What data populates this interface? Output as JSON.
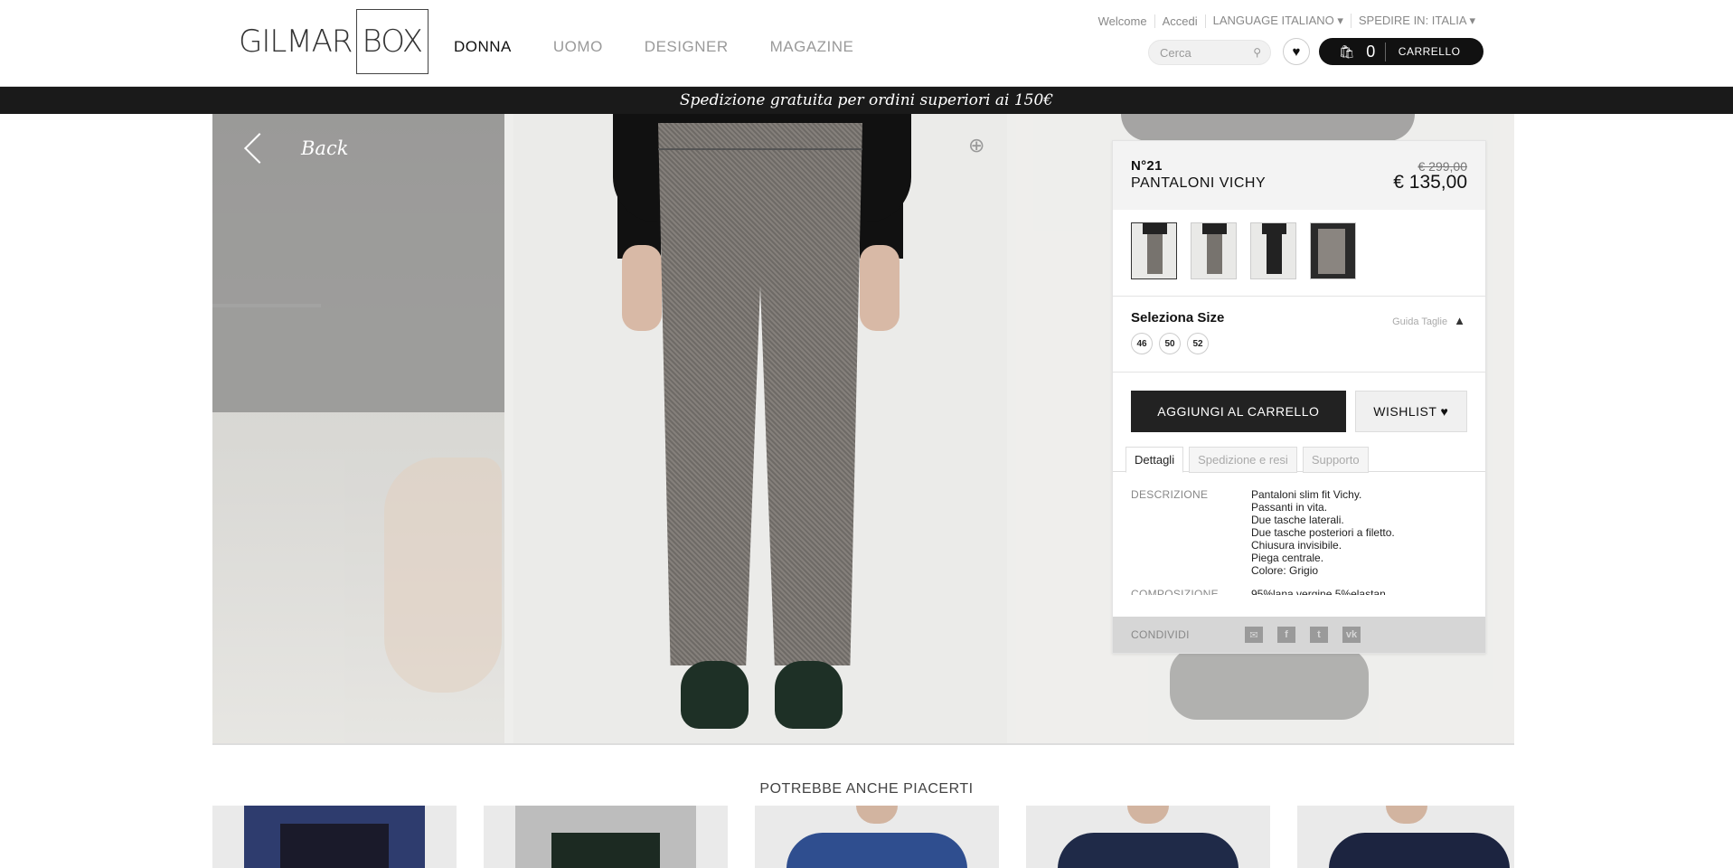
{
  "header": {
    "logo": "GILMAR",
    "logo_box": "BOX",
    "nav": [
      "DONNA",
      "UOMO",
      "DESIGNER",
      "MAGAZINE"
    ],
    "topbar": {
      "welcome": "Welcome",
      "login": "Accedi",
      "language": "LANGUAGE ITALIANO ▾",
      "ship_to": "SPEDIRE IN: ITALIA ▾"
    },
    "search_placeholder": "Cerca",
    "cart_count": "0",
    "cart_label": "CARRELLO"
  },
  "promo": "Spedizione gratuita per ordini superiori ai 150€",
  "gallery": {
    "back_label": "Back"
  },
  "product": {
    "code": "N°21",
    "name": "PANTALONI VICHY",
    "old_price": "€ 299,00",
    "price": "€ 135,00",
    "size_label": "Seleziona Size",
    "size_guide": "Guida Taglie",
    "sizes": [
      "46",
      "50",
      "52"
    ],
    "add_to_cart": "AGGIUNGI AL CARRELLO",
    "wishlist": "WISHLIST ♥",
    "tabs": [
      "Dettagli",
      "Spedizione e resi",
      "Supporto"
    ],
    "details": {
      "desc_label": "DESCRIZIONE",
      "desc_lines": [
        "Pantaloni slim fit Vichy.",
        "Passanti in vita.",
        "Due tasche laterali.",
        "Due tasche posteriori a filetto.",
        "Chiusura invisibile.",
        "Piega centrale.",
        "Colore: Grigio"
      ],
      "comp_label": "COMPOSIZIONE",
      "comp_value": "95%lana vergine 5%elastan"
    },
    "share_label": "CONDIVIDI"
  },
  "related": {
    "title": "POTREBBE ANCHE PIACERTI"
  },
  "colors": {
    "promo_bg": "#1a1a1a",
    "cart_bg": "#111111",
    "panel_head": "#f3f3f3",
    "share_bg": "#d6d6d6"
  }
}
